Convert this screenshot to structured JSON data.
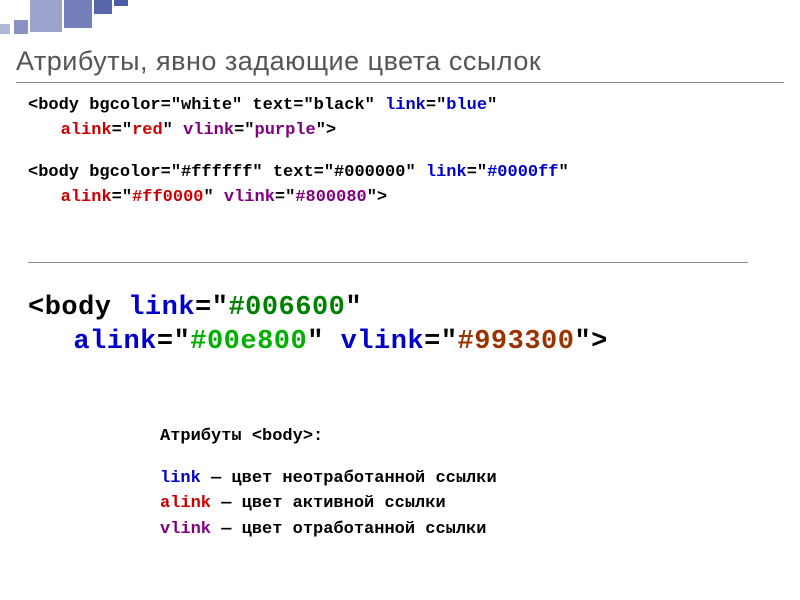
{
  "title": "Атрибуты, явно задающие цвета ссылок",
  "code1": {
    "line1": {
      "pre": "<body bgcolor=\"white\" text=\"black\" ",
      "link": "link",
      "eq1": "=\"",
      "linkval": "blue",
      "q1": "\""
    },
    "line2": {
      "alink": "alink",
      "eq1": "=\"",
      "alinkval": "red",
      "q1": "\" ",
      "vlink": "vlink",
      "eq2": "=\"",
      "vlinkval": "purple",
      "q2": "\">"
    },
    "line3": {
      "pre": "<body bgcolor=\"#ffffff\" text=\"#000000\" ",
      "link": "link",
      "eq1": "=\"",
      "linkval": "#0000ff",
      "q1": "\""
    },
    "line4": {
      "alink": "alink",
      "eq1": "=\"",
      "alinkval": "#ff0000",
      "q1": "\" ",
      "vlink": "vlink",
      "eq2": "=\"",
      "vlinkval": "#800080",
      "q2": "\">"
    }
  },
  "code2": {
    "line1": {
      "pre": "<body ",
      "link": "link",
      "eq1": "=\"",
      "linkval": "#006600",
      "q1": "\""
    },
    "line2": {
      "alink": "alink",
      "eq1": "=\"",
      "alinkval": "#00e800",
      "q1": "\" ",
      "vlink": "vlink",
      "eq2": "=\"",
      "vlinkval": "#993300",
      "q2": "\">"
    }
  },
  "attrs": {
    "heading": "Атрибуты <body>:",
    "link_name": "link",
    "link_desc": " — цвет неотработанной ссылки",
    "alink_name": "alink",
    "alink_desc": " — цвет активной ссылки",
    "vlink_name": "vlink",
    "vlink_desc": " — цвет отработанной ссылки"
  }
}
